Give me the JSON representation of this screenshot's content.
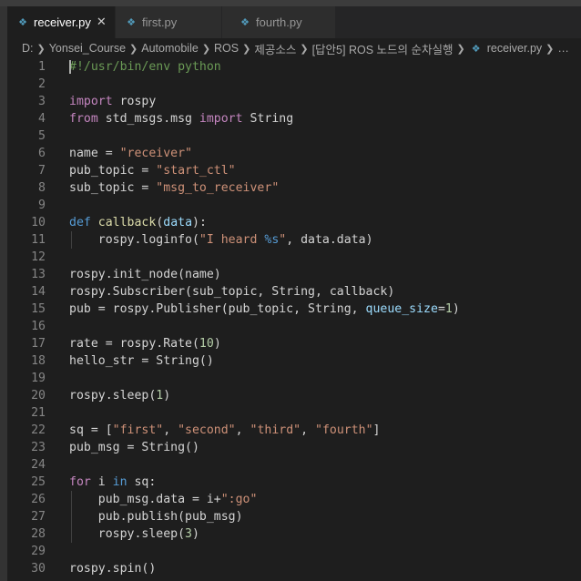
{
  "tabs": [
    {
      "label": "receiver.py",
      "active": true,
      "icon": "python-icon"
    },
    {
      "label": "first.py",
      "active": false,
      "icon": "python-icon"
    },
    {
      "label": "fourth.py",
      "active": false,
      "icon": "python-icon"
    }
  ],
  "close_glyph": "✕",
  "breadcrumb": [
    "D:",
    "Yonsei_Course",
    "Automobile",
    "ROS",
    "제공소스",
    "[답안5] ROS 노드의 순차실행",
    "receiver.py"
  ],
  "colors": {
    "keyword": "#c586c0",
    "def": "#569cd6",
    "function": "#dcdcaa",
    "string": "#ce9178",
    "number": "#b5cea8",
    "param": "#9cdcfe",
    "comment": "#6a9955",
    "text": "#d4d4d4",
    "line_number": "#858585",
    "python_icon": "#519aba"
  },
  "code_lines": [
    {
      "n": 1,
      "tokens": [
        [
          "cm",
          "#!/usr/bin/env python"
        ]
      ]
    },
    {
      "n": 2,
      "tokens": []
    },
    {
      "n": 3,
      "tokens": [
        [
          "kw",
          "import"
        ],
        [
          "tx",
          " rospy"
        ]
      ]
    },
    {
      "n": 4,
      "tokens": [
        [
          "kw",
          "from"
        ],
        [
          "tx",
          " std_msgs.msg "
        ],
        [
          "kw",
          "import"
        ],
        [
          "tx",
          " String"
        ]
      ]
    },
    {
      "n": 5,
      "tokens": []
    },
    {
      "n": 6,
      "tokens": [
        [
          "tx",
          "name = "
        ],
        [
          "st",
          "\"receiver\""
        ]
      ]
    },
    {
      "n": 7,
      "tokens": [
        [
          "tx",
          "pub_topic = "
        ],
        [
          "st",
          "\"start_ctl\""
        ]
      ]
    },
    {
      "n": 8,
      "tokens": [
        [
          "tx",
          "sub_topic = "
        ],
        [
          "st",
          "\"msg_to_receiver\""
        ]
      ]
    },
    {
      "n": 9,
      "tokens": []
    },
    {
      "n": 10,
      "tokens": [
        [
          "def",
          "def"
        ],
        [
          "tx",
          " "
        ],
        [
          "fn",
          "callback"
        ],
        [
          "tx",
          "("
        ],
        [
          "pr",
          "data"
        ],
        [
          "tx",
          "):"
        ]
      ]
    },
    {
      "n": 11,
      "indent": true,
      "tokens": [
        [
          "tx",
          "    rospy.loginfo("
        ],
        [
          "st",
          "\"I heard "
        ],
        [
          "def",
          "%s"
        ],
        [
          "st",
          "\""
        ],
        [
          "tx",
          ", data.data)"
        ]
      ]
    },
    {
      "n": 12,
      "tokens": []
    },
    {
      "n": 13,
      "tokens": [
        [
          "tx",
          "rospy.init_node(name)"
        ]
      ]
    },
    {
      "n": 14,
      "tokens": [
        [
          "tx",
          "rospy.Subscriber(sub_topic, String, callback)"
        ]
      ]
    },
    {
      "n": 15,
      "tokens": [
        [
          "tx",
          "pub = rospy.Publisher(pub_topic, String, "
        ],
        [
          "pr",
          "queue_size"
        ],
        [
          "tx",
          "="
        ],
        [
          "nm",
          "1"
        ],
        [
          "tx",
          ")"
        ]
      ]
    },
    {
      "n": 16,
      "tokens": []
    },
    {
      "n": 17,
      "tokens": [
        [
          "tx",
          "rate = rospy.Rate("
        ],
        [
          "nm",
          "10"
        ],
        [
          "tx",
          ")"
        ]
      ]
    },
    {
      "n": 18,
      "tokens": [
        [
          "tx",
          "hello_str = String()"
        ]
      ]
    },
    {
      "n": 19,
      "tokens": []
    },
    {
      "n": 20,
      "tokens": [
        [
          "tx",
          "rospy.sleep("
        ],
        [
          "nm",
          "1"
        ],
        [
          "tx",
          ")"
        ]
      ]
    },
    {
      "n": 21,
      "tokens": []
    },
    {
      "n": 22,
      "tokens": [
        [
          "tx",
          "sq = ["
        ],
        [
          "st",
          "\"first\""
        ],
        [
          "tx",
          ", "
        ],
        [
          "st",
          "\"second\""
        ],
        [
          "tx",
          ", "
        ],
        [
          "st",
          "\"third\""
        ],
        [
          "tx",
          ", "
        ],
        [
          "st",
          "\"fourth\""
        ],
        [
          "tx",
          "]"
        ]
      ]
    },
    {
      "n": 23,
      "tokens": [
        [
          "tx",
          "pub_msg = String()"
        ]
      ]
    },
    {
      "n": 24,
      "tokens": []
    },
    {
      "n": 25,
      "tokens": [
        [
          "kw",
          "for"
        ],
        [
          "tx",
          " i "
        ],
        [
          "def",
          "in"
        ],
        [
          "tx",
          " sq:"
        ]
      ]
    },
    {
      "n": 26,
      "indent": true,
      "tokens": [
        [
          "tx",
          "    pub_msg.data = i+"
        ],
        [
          "st",
          "\":go\""
        ]
      ]
    },
    {
      "n": 27,
      "indent": true,
      "tokens": [
        [
          "tx",
          "    pub.publish(pub_msg)"
        ]
      ]
    },
    {
      "n": 28,
      "indent": true,
      "tokens": [
        [
          "tx",
          "    rospy.sleep("
        ],
        [
          "nm",
          "3"
        ],
        [
          "tx",
          ")"
        ]
      ]
    },
    {
      "n": 29,
      "tokens": []
    },
    {
      "n": 30,
      "tokens": [
        [
          "tx",
          "rospy.spin()"
        ]
      ]
    }
  ]
}
